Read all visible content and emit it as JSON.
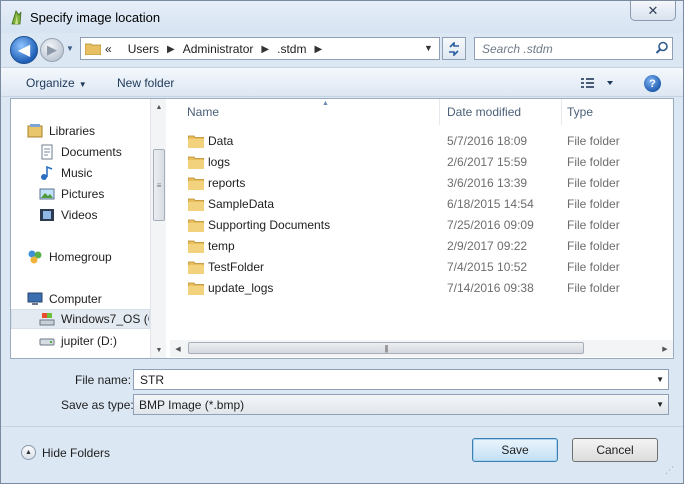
{
  "window": {
    "title": "Specify image location",
    "close_glyph": "✕"
  },
  "navigation": {
    "back_glyph": "◀",
    "forward_glyph": "▶",
    "breadcrumb": [
      "Users",
      "Administrator",
      ".stdm"
    ],
    "crumb_prefix": "«",
    "search_placeholder": "Search .stdm"
  },
  "toolbar": {
    "organize_label": "Organize",
    "new_folder_label": "New folder",
    "help_label": "?"
  },
  "nav_pane": {
    "items": [
      {
        "label": "Libraries",
        "icon": "libraries-icon"
      },
      {
        "label": "Documents",
        "icon": "documents-icon"
      },
      {
        "label": "Music",
        "icon": "music-icon"
      },
      {
        "label": "Pictures",
        "icon": "pictures-icon"
      },
      {
        "label": "Videos",
        "icon": "videos-icon"
      },
      {
        "label": "Homegroup",
        "icon": "homegroup-icon"
      },
      {
        "label": "Computer",
        "icon": "computer-icon"
      },
      {
        "label": "Windows7_OS (C",
        "icon": "drive-c-icon"
      },
      {
        "label": "jupiter (D:)",
        "icon": "drive-d-icon"
      }
    ]
  },
  "file_list": {
    "columns": {
      "name": "Name",
      "date": "Date modified",
      "type": "Type"
    },
    "rows": [
      {
        "name": "Data",
        "date": "5/7/2016 18:09",
        "type": "File folder"
      },
      {
        "name": "logs",
        "date": "2/6/2017 15:59",
        "type": "File folder"
      },
      {
        "name": "reports",
        "date": "3/6/2016 13:39",
        "type": "File folder"
      },
      {
        "name": "SampleData",
        "date": "6/18/2015 14:54",
        "type": "File folder"
      },
      {
        "name": "Supporting Documents",
        "date": "7/25/2016 09:09",
        "type": "File folder"
      },
      {
        "name": "temp",
        "date": "2/9/2017 09:22",
        "type": "File folder"
      },
      {
        "name": "TestFolder",
        "date": "7/4/2015 10:52",
        "type": "File folder"
      },
      {
        "name": "update_logs",
        "date": "7/14/2016 09:38",
        "type": "File folder"
      }
    ]
  },
  "form": {
    "file_name_label": "File name:",
    "file_name_value": "STR",
    "save_type_label": "Save as type:",
    "save_type_value": "BMP Image (*.bmp)"
  },
  "footer": {
    "hide_folders_label": "Hide Folders",
    "save_label": "Save",
    "cancel_label": "Cancel"
  }
}
